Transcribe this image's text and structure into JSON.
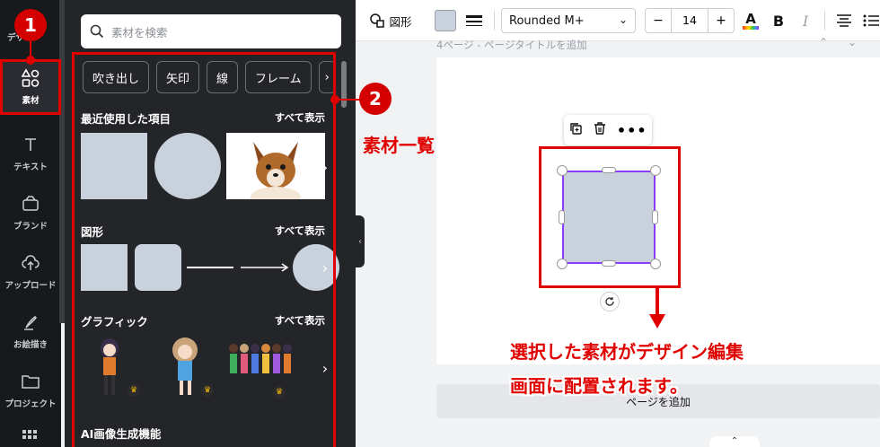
{
  "rail": {
    "top_cut_label": "デザイン",
    "items": [
      {
        "label": "素材",
        "icon": "elements-icon"
      },
      {
        "label": "テキスト",
        "icon": "text-icon"
      },
      {
        "label": "ブランド",
        "icon": "brand-icon"
      },
      {
        "label": "アップロード",
        "icon": "upload-icon"
      },
      {
        "label": "お絵描き",
        "icon": "draw-icon"
      },
      {
        "label": "プロジェクト",
        "icon": "folder-icon"
      }
    ]
  },
  "panel": {
    "search_placeholder": "素材を検索",
    "chips": [
      "吹き出し",
      "矢印",
      "線",
      "フレーム"
    ],
    "sections": {
      "recent": {
        "title": "最近使用した項目",
        "see_all": "すべて表示"
      },
      "shapes": {
        "title": "図形",
        "see_all": "すべて表示"
      },
      "graphics": {
        "title": "グラフィック",
        "see_all": "すべて表示"
      },
      "ai": {
        "title": "AI画像生成機能"
      }
    }
  },
  "toolbar": {
    "shape_label": "図形",
    "font_name": "Rounded M+",
    "font_size": "14",
    "minus": "−",
    "plus": "+",
    "bold": "B",
    "italic": "I",
    "text_color_letter": "A"
  },
  "canvas": {
    "page_title": "4ページ - ページタイトルを追加",
    "add_page": "ページを追加"
  },
  "annotations": {
    "badge1": "1",
    "badge2": "2",
    "elements_list": "素材一覧",
    "callout_line1": "選択した素材がデザイン編集",
    "callout_line2": "画面に配置されます。"
  },
  "colors": {
    "accent_red": "#e10000",
    "selection_purple": "#8b3dff",
    "shape_fill": "#c9d1dc"
  }
}
